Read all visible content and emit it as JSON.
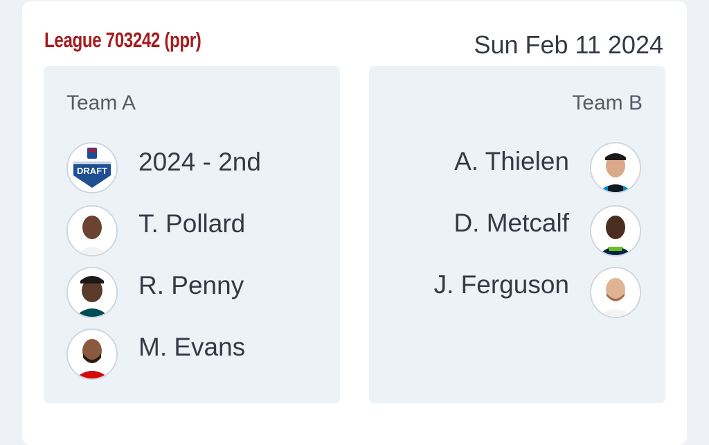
{
  "league": {
    "title": "League 703242 (ppr)"
  },
  "date": "Sun Feb 11 2024",
  "team_a": {
    "name": "Team A",
    "assets": [
      {
        "label": "2024 - 2nd",
        "icon": "nfl-draft-logo-icon"
      },
      {
        "label": "T. Pollard",
        "icon": "player-headshot-icon"
      },
      {
        "label": "R. Penny",
        "icon": "player-headshot-icon"
      },
      {
        "label": "M. Evans",
        "icon": "player-headshot-icon"
      }
    ]
  },
  "team_b": {
    "name": "Team B",
    "assets": [
      {
        "label": "A. Thielen",
        "icon": "player-headshot-icon"
      },
      {
        "label": "D. Metcalf",
        "icon": "player-headshot-icon"
      },
      {
        "label": "J. Ferguson",
        "icon": "player-headshot-icon"
      }
    ]
  },
  "colors": {
    "league_title": "#a51c1f",
    "panel_bg": "#edf2f7",
    "text_primary": "#333a44",
    "text_secondary": "#555c66"
  }
}
